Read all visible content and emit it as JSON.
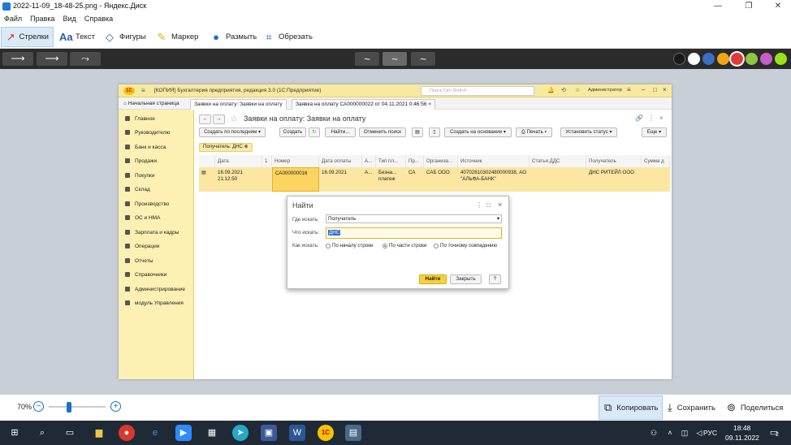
{
  "window": {
    "title": "2022-11-09_18-48-25.png - Яндекс.Диск"
  },
  "menu": [
    "Файл",
    "Правка",
    "Вид",
    "Справка"
  ],
  "tools": [
    {
      "label": "Стрелки",
      "icon": "arrow-icon"
    },
    {
      "label": "Текст",
      "icon": "text-icon"
    },
    {
      "label": "Фигуры",
      "icon": "shapes-icon"
    },
    {
      "label": "Маркер",
      "icon": "marker-icon"
    },
    {
      "label": "Размыть",
      "icon": "blur-icon"
    },
    {
      "label": "Обрезать",
      "icon": "crop-icon"
    }
  ],
  "colors": [
    "#1a1a1a",
    "#ffffff",
    "#3c6fc4",
    "#f2a516",
    "#e03a3a",
    "#8dc63f",
    "#c55ec7",
    "#9ae11b"
  ],
  "onec": {
    "title": "[КОПИЯ] Бухгалтерия предприятия, редакция 3.0 (1С:Предприятие)",
    "search_placeholder": "Поиск Ctrl+Shift+F",
    "user": "Администратор",
    "tabs": [
      "Начальная страница",
      "Заявки на оплату: Заявки на оплату",
      "Заявка на оплату СА000000022 от 04.11.2021 0:46:56"
    ],
    "sidebar": [
      "Главное",
      "Руководителю",
      "Банк и касса",
      "Продажи",
      "Покупки",
      "Склад",
      "Производство",
      "ОС и НМА",
      "Зарплата и кадры",
      "Операции",
      "Отчеты",
      "Справочники",
      "Администрирование",
      "модуль Управления"
    ],
    "page_title": "Заявки на оплату: Заявки на оплату",
    "buttons": {
      "create_by_last": "Создать по последним",
      "create": "Создать",
      "find": "Найти...",
      "cancel_search": "Отменить поиск",
      "create_based": "Создать на основании",
      "print": "Печать",
      "set_status": "Установить статус",
      "more": "Еще"
    },
    "filter": "Получатель: ДНС",
    "columns": [
      "Дата",
      "1",
      "Номер",
      "Дата оплаты",
      "А...",
      "Тип пл...",
      "Пр...",
      "Организа...",
      "Источник",
      "Статья ДДС",
      "Получатель",
      "Сумма д"
    ],
    "row": {
      "date": "16.09.2021",
      "time": "21:12:50",
      "number": "СА000000016",
      "pay_date": "16.09.2021",
      "a": "А...",
      "type": "Безна... платеж",
      "pr": "СА",
      "org": "САБ ООО",
      "source": "40702810302480000938, АО \"АЛЬФА-БАНК\"",
      "recipient": "ДНС РИТЕЙЛ ООО"
    }
  },
  "dialog": {
    "title": "Найти",
    "where_label": "Где искать:",
    "where_value": "Получатель",
    "what_label": "Что искать:",
    "what_value": "ДНС",
    "how_label": "Как искать:",
    "options": [
      "По началу строки",
      "По части строки",
      "По точному совпадению"
    ],
    "selected": "По части строки",
    "find": "Найти",
    "close": "Закрыть",
    "help": "?"
  },
  "statusbar": {
    "zoom": "70%",
    "zoom_level": 0.35,
    "copy": "Копировать",
    "save": "Сохранить",
    "share": "Поделиться"
  },
  "taskbar": {
    "lang": "РУС",
    "time": "18:48",
    "date": "09.11.2022",
    "notif": "2"
  }
}
